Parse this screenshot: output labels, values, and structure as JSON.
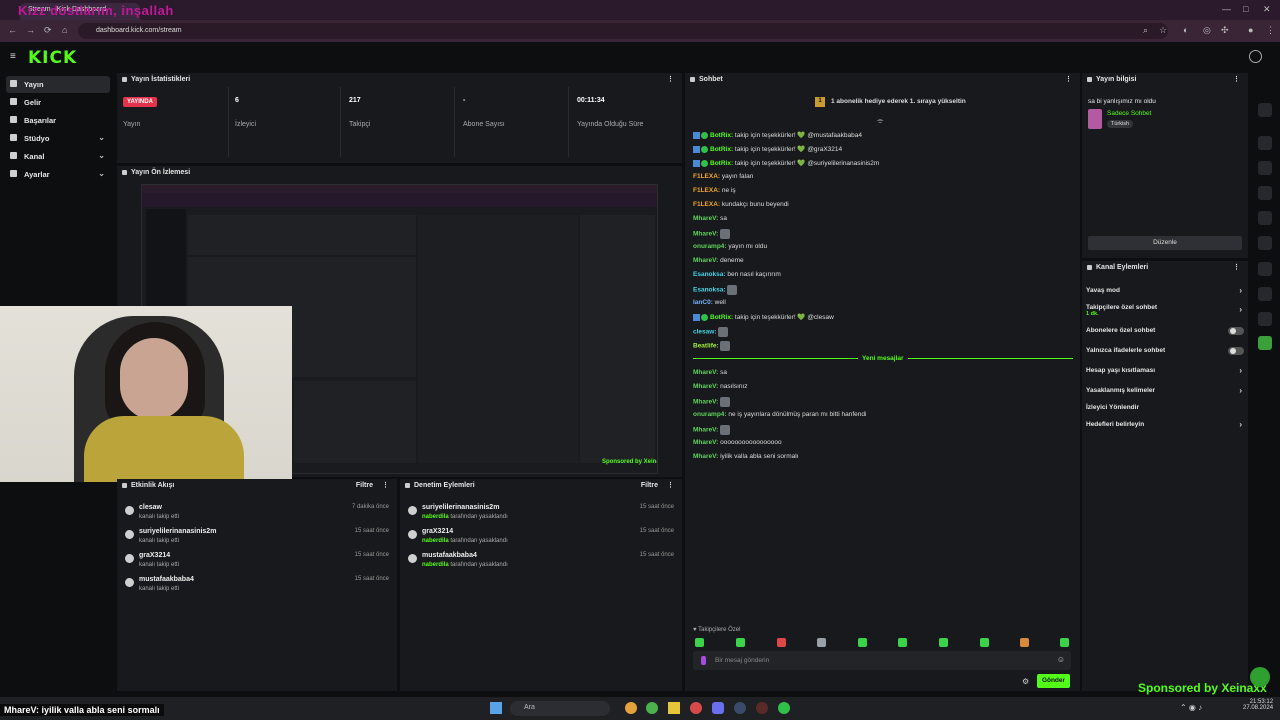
{
  "browser": {
    "overlay_title": "Kızz dostlarım, inşallah",
    "tab_title": "Stream - Kick Dashboard",
    "url": "dashboard.kick.com/stream"
  },
  "app": {
    "logo": "KICK"
  },
  "sidebar": {
    "items": [
      {
        "label": "Yayın",
        "active": true
      },
      {
        "label": "Gelir"
      },
      {
        "label": "Başarılar"
      },
      {
        "label": "Stüdyo",
        "expandable": true
      },
      {
        "label": "Kanal",
        "expandable": true
      },
      {
        "label": "Ayarlar",
        "expandable": true
      }
    ]
  },
  "stats": {
    "title": "Yayın İstatistikleri",
    "live_badge": "YAYINDA",
    "live_label": "Yayın",
    "viewers_value": "6",
    "viewers_label": "İzleyici",
    "followers_value": "217",
    "followers_label": "Takipçi",
    "subs_value": "-",
    "subs_label": "Abone Sayısı",
    "uptime_value": "00:11:34",
    "uptime_label": "Yayında Olduğu Süre"
  },
  "preview": {
    "title": "Yayın Ön İzlemesi"
  },
  "activity": {
    "title": "Etkinlik Akışı",
    "filter": "Filtre",
    "rows": [
      {
        "name": "clesaw",
        "sub": "kanalı takip etti",
        "time": "7 dakika önce"
      },
      {
        "name": "suriyelilerinanasinis2m",
        "sub": "kanalı takip etti",
        "time": "15 saat önce"
      },
      {
        "name": "graX3214",
        "sub": "kanalı takip etti",
        "time": "15 saat önce"
      },
      {
        "name": "mustafaakbaba4",
        "sub": "kanalı takip etti",
        "time": "15 saat önce"
      }
    ]
  },
  "moderation": {
    "title": "Denetim Eylemleri",
    "filter": "Filtre",
    "rows": [
      {
        "name": "suriyelilerinanasinis2m",
        "by": "naberdila",
        "sub": "tarafından yasaklandı",
        "time": "15 saat önce"
      },
      {
        "name": "graX3214",
        "by": "naberdila",
        "sub": "tarafından yasaklandı",
        "time": "15 saat önce"
      },
      {
        "name": "mustafaakbaba4",
        "by": "naberdila",
        "sub": "tarafından yasaklandı",
        "time": "15 saat önce"
      }
    ]
  },
  "chat": {
    "title": "Sohbet",
    "pinned_rank": "1",
    "pinned": "1 abonelik hediye ederek 1. sıraya yükseltin",
    "messages": [
      {
        "user": "BotRix",
        "cls": "u-bot",
        "bot": true,
        "text": " takip için teşekkürler! 💚 @mustafaakbaba4"
      },
      {
        "user": "BotRix",
        "cls": "u-bot",
        "bot": true,
        "text": " takip için teşekkürler! 💚 @graX3214"
      },
      {
        "user": "BotRix",
        "cls": "u-bot",
        "bot": true,
        "text": " takip için teşekkürler! 💚 @suriyelilerinanasinis2m"
      },
      {
        "user": "F1LEXA",
        "cls": "u-orange",
        "text": " yayın falan"
      },
      {
        "user": "F1LEXA",
        "cls": "u-orange",
        "text": " ne iş"
      },
      {
        "user": "F1LEXA",
        "cls": "u-orange",
        "text": " kundakçı bunu beyendi"
      },
      {
        "user": "MhareV",
        "cls": "u-green",
        "text": " sa"
      },
      {
        "user": "MhareV",
        "cls": "u-green",
        "text": " ",
        "emote": true
      },
      {
        "user": "onuramp4",
        "cls": "u-green",
        "text": " yayın mı oldu"
      },
      {
        "user": "MhareV",
        "cls": "u-green",
        "text": " deneme"
      },
      {
        "user": "Esanoksa",
        "cls": "u-cyan",
        "text": " ben nasıl kaçırırım"
      },
      {
        "user": "Esanoksa",
        "cls": "u-cyan",
        "text": " ",
        "emote": true
      },
      {
        "user": "lanC0",
        "cls": "u-blue",
        "text": " well"
      },
      {
        "user": "BotRix",
        "cls": "u-bot",
        "bot": true,
        "text": " takip için teşekkürler! 💚 @clesaw"
      },
      {
        "user": "clesaw",
        "cls": "u-cyan",
        "text": " ",
        "emote": true
      },
      {
        "user": "Beatlife",
        "cls": "u-lime",
        "text": " ",
        "emote": true
      }
    ],
    "divider": "Yeni mesajlar",
    "new_messages": [
      {
        "user": "MhareV",
        "cls": "u-green",
        "text": " sa"
      },
      {
        "user": "MhareV",
        "cls": "u-green",
        "text": " nasılsınız"
      },
      {
        "user": "MhareV",
        "cls": "u-green",
        "text": " ",
        "emote": true
      },
      {
        "user": "onuramp4",
        "cls": "u-green",
        "text": " ne iş yayınlara dönülmüş paran mı bitti hanfendi"
      },
      {
        "user": "MhareV",
        "cls": "u-green",
        "text": " ",
        "emote": true
      },
      {
        "user": "MhareV",
        "cls": "u-green",
        "text": " ooooooooooooooooo"
      },
      {
        "user": "MhareV",
        "cls": "u-green",
        "text": " iyilik valla abla seni sormalı"
      }
    ],
    "followers_only": "Takipçilere Özel",
    "input_placeholder": "Bir mesaj gönderin",
    "send_label": "Gönder"
  },
  "stream_info": {
    "title": "Yayın bilgisi",
    "stream_title": "sa bi yanlışımız mı oldu",
    "category": "Sadece Sohbet",
    "language": "Türkish",
    "edit_label": "Düzenle"
  },
  "channel_actions": {
    "title": "Kanal Eylemleri",
    "rows": [
      {
        "label": "Yavaş mod",
        "type": "arrow"
      },
      {
        "label": "Takipçilere özel sohbet",
        "sub": "1 dk.",
        "type": "arrow"
      },
      {
        "label": "Abonelere özel sohbet",
        "type": "toggle"
      },
      {
        "label": "Yalnızca ifadelerle sohbet",
        "type": "toggle"
      },
      {
        "label": "Hesap yaşı kısıtlaması",
        "type": "arrow"
      },
      {
        "label": "Yasaklanmış kelimeler",
        "type": "arrow"
      },
      {
        "label": "İzleyici Yönlendir",
        "type": "none"
      },
      {
        "label": "Hedefleri belirleyin",
        "type": "arrow"
      }
    ]
  },
  "overlay": {
    "sponsor": "Sponsored by Xeinaxx",
    "caption_user": "MhareV",
    "caption_text": ": iyilik valla abla seni sormalı"
  },
  "taskbar": {
    "search": "Ara",
    "time": "21:53:12",
    "date": "27.08.2024"
  },
  "colors": {
    "accent": "#53fc18",
    "live": "#e4344b",
    "panel": "#18191c"
  }
}
